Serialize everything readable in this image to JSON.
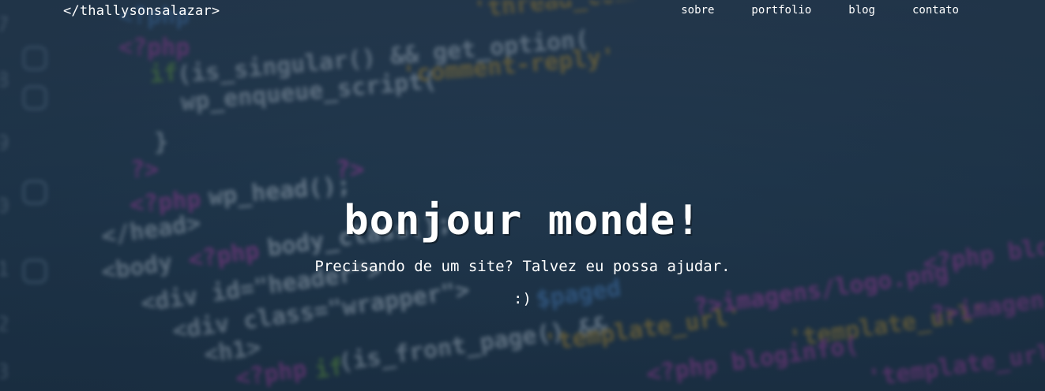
{
  "header": {
    "brand": "</thallysonsalazar>",
    "nav": [
      "sobre",
      "portfolio",
      "blog",
      "contato"
    ]
  },
  "hero": {
    "title": "bonjour monde!",
    "subtitle": "Precisando de um site? Talvez eu possa ajudar.",
    "smiley": ":)"
  },
  "colors": {
    "background": "#223a50",
    "text": "#ffffff",
    "code_magenta": "#c23fb1",
    "code_green": "#6fae3a",
    "code_orange": "#c99a2e",
    "code_blue": "#4c86c9",
    "code_white": "#c9d6e2"
  }
}
